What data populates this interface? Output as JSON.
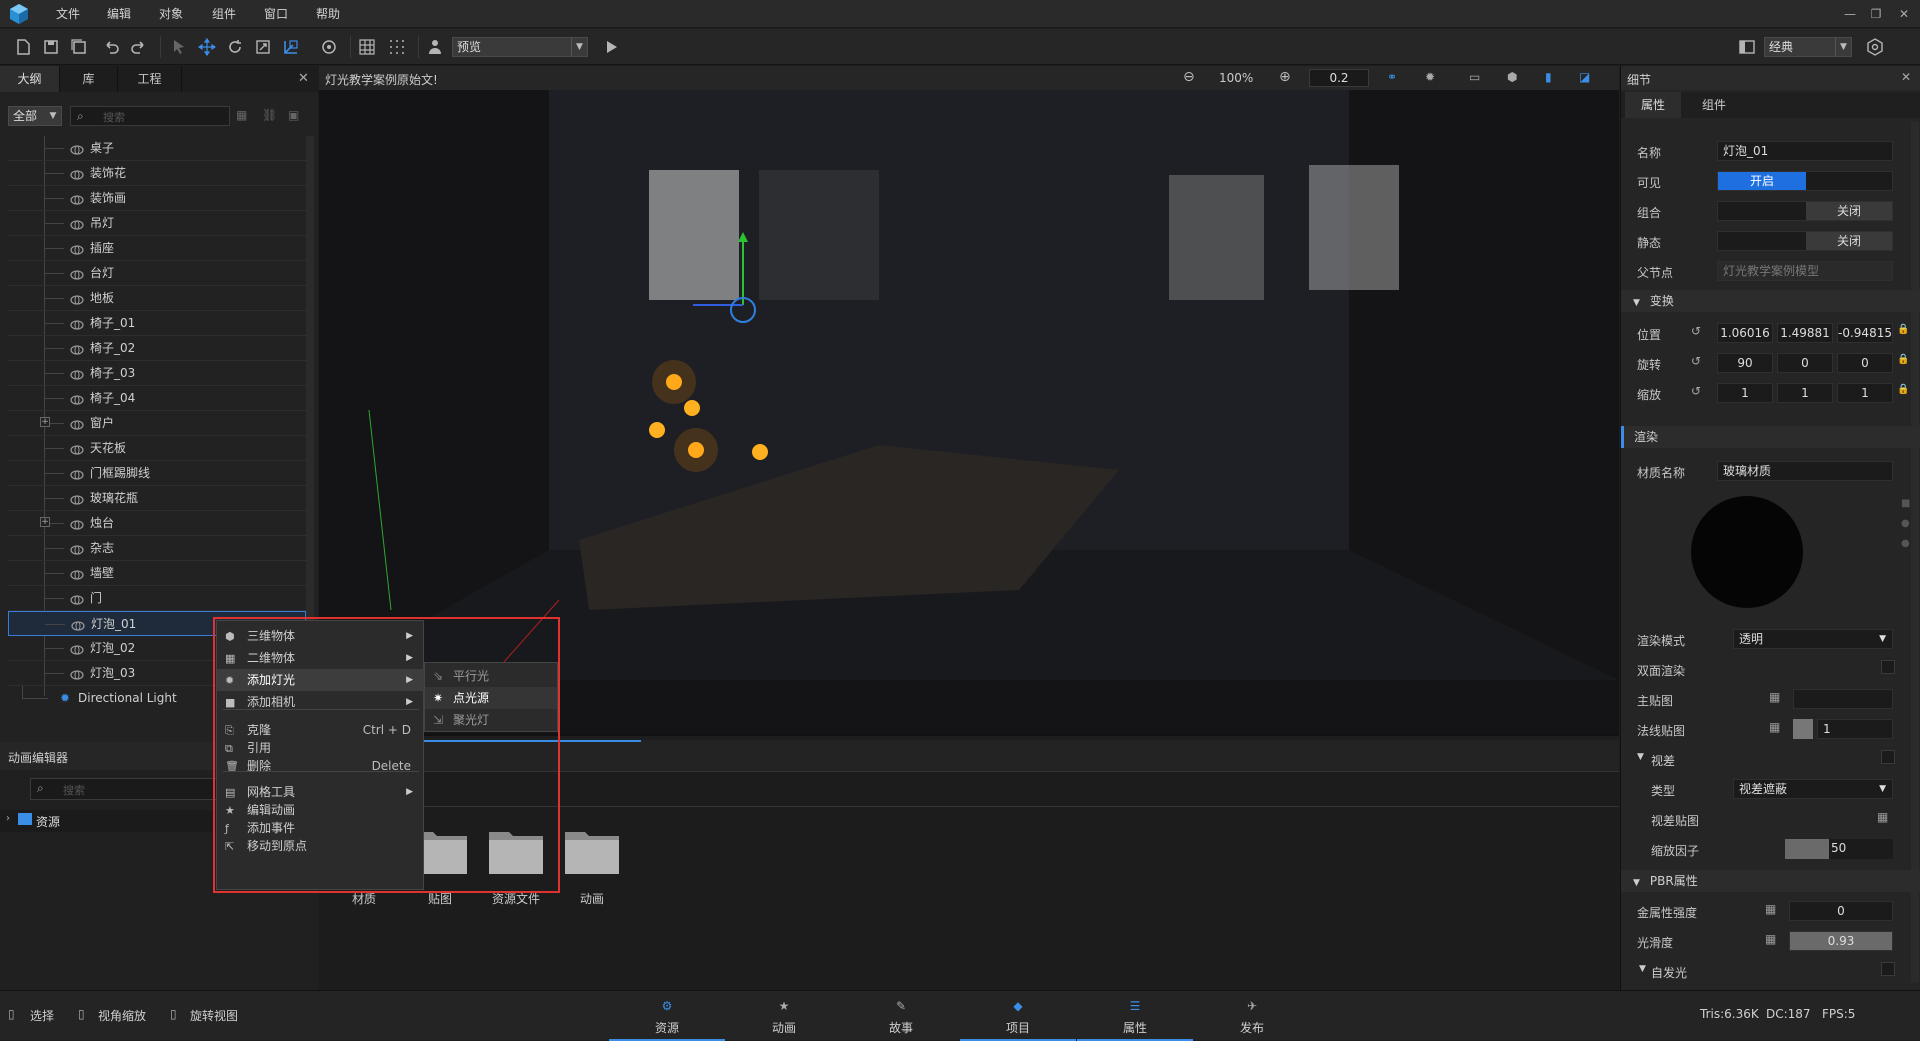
{
  "menubar": {
    "items": [
      "文件",
      "编辑",
      "对象",
      "组件",
      "窗口",
      "帮助"
    ]
  },
  "toolbar": {
    "mode_select": "预览",
    "layout_select": "经典"
  },
  "outline": {
    "tabs": [
      "大纲",
      "库",
      "工程"
    ],
    "filter": "全部",
    "search_placeholder": "搜索",
    "items": [
      {
        "label": "桌子",
        "expand": false
      },
      {
        "label": "装饰花",
        "expand": false
      },
      {
        "label": "装饰画",
        "expand": false
      },
      {
        "label": "吊灯",
        "expand": false
      },
      {
        "label": "插座",
        "expand": false
      },
      {
        "label": "台灯",
        "expand": false
      },
      {
        "label": "地板",
        "expand": false
      },
      {
        "label": "椅子_01",
        "expand": false
      },
      {
        "label": "椅子_02",
        "expand": false
      },
      {
        "label": "椅子_03",
        "expand": false
      },
      {
        "label": "椅子_04",
        "expand": false
      },
      {
        "label": "窗户",
        "expand": true
      },
      {
        "label": "天花板",
        "expand": false
      },
      {
        "label": "门框踢脚线",
        "expand": false
      },
      {
        "label": "玻璃花瓶",
        "expand": false
      },
      {
        "label": "烛台",
        "expand": true
      },
      {
        "label": "杂志",
        "expand": false
      },
      {
        "label": "墙壁",
        "expand": false
      },
      {
        "label": "门",
        "expand": false
      },
      {
        "label": "灯泡_01",
        "expand": false,
        "selected": true
      },
      {
        "label": "灯泡_02",
        "expand": false
      },
      {
        "label": "灯泡_03",
        "expand": false
      }
    ],
    "directional_light": "Directional Light"
  },
  "viewport": {
    "title": "灯光教学案例原始文!",
    "zoom": "100%",
    "step": "0.2"
  },
  "anim_editor": {
    "title": "动画编辑器",
    "search_placeholder": "搜索",
    "tree_root": "资源"
  },
  "assets": {
    "folders": [
      "材质",
      "贴图",
      "资源文件",
      "动画"
    ]
  },
  "details": {
    "title": "细节",
    "tabs": [
      "属性",
      "组件"
    ],
    "name_label": "名称",
    "name_value": "灯泡_01",
    "visible_label": "可见",
    "visible_value": "开启",
    "group_label": "组合",
    "group_value": "关闭",
    "static_label": "静态",
    "static_value": "关闭",
    "parent_label": "父节点",
    "parent_value": "灯光教学案例模型",
    "transform_title": "变换",
    "position_label": "位置",
    "position": [
      "1.06016",
      "1.49881",
      "-0.94815"
    ],
    "rotation_label": "旋转",
    "rotation": [
      "90",
      "0",
      "0"
    ],
    "scale_label": "缩放",
    "scale": [
      "1",
      "1",
      "1"
    ],
    "render_title": "渲染",
    "material_label": "材质名称",
    "material_value": "玻璃材质",
    "render_mode_label": "渲染模式",
    "render_mode_value": "透明",
    "double_side_label": "双面渲染",
    "main_tex_label": "主贴图",
    "normal_tex_label": "法线贴图",
    "normal_tex_value": "1",
    "parallax_title": "视差",
    "type_label": "类型",
    "type_value": "视差遮蔽",
    "parallax_tex_label": "视差贴图",
    "scale_factor_label": "缩放因子",
    "scale_factor_value": "50",
    "pbr_title": "PBR属性",
    "metal_label": "金属性强度",
    "metal_value": "0",
    "smooth_label": "光滑度",
    "smooth_value": "0.93",
    "emissive_title": "自发光"
  },
  "context_menu": {
    "items": [
      {
        "label": "三维物体",
        "shortcut": "",
        "submenu": true
      },
      {
        "label": "二维物体",
        "shortcut": "",
        "submenu": true
      },
      {
        "label": "添加灯光",
        "shortcut": "",
        "submenu": true
      },
      {
        "label": "添加相机",
        "shortcut": "",
        "submenu": true
      },
      {
        "label": "克隆",
        "shortcut": "Ctrl + D",
        "submenu": false
      },
      {
        "label": "引用",
        "shortcut": "",
        "submenu": false
      },
      {
        "label": "删除",
        "shortcut": "Delete",
        "submenu": false
      },
      {
        "label": "网格工具",
        "shortcut": "",
        "submenu": true
      },
      {
        "label": "编辑动画",
        "shortcut": "",
        "submenu": false
      },
      {
        "label": "添加事件",
        "shortcut": "",
        "submenu": false
      },
      {
        "label": "移动到原点",
        "shortcut": "",
        "submenu": false
      }
    ],
    "submenu": [
      "平行光",
      "点光源",
      "聚光灯"
    ]
  },
  "statusbar": {
    "tools": [
      "选择",
      "视角缩放",
      "旋转视图"
    ],
    "tabs": [
      "资源",
      "动画",
      "故事",
      "项目",
      "属性",
      "发布"
    ],
    "tris": "Tris:6.36K",
    "dc": "DC:187",
    "fps": "FPS:5"
  }
}
